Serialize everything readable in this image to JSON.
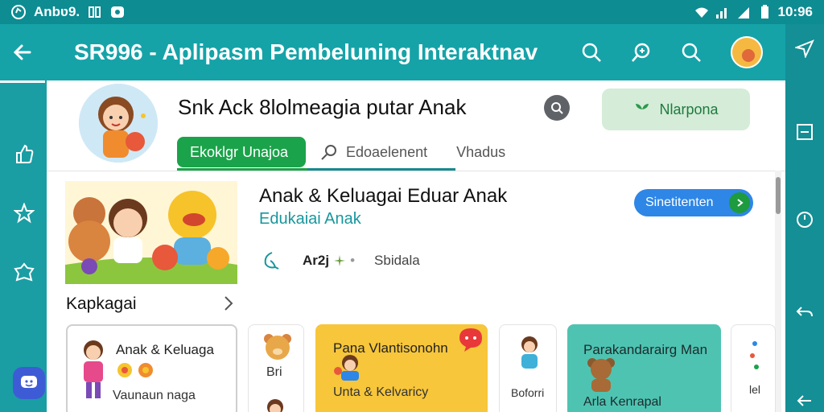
{
  "status_bar": {
    "app_label": "Anbʋ9.",
    "clock": "10:96"
  },
  "app_bar": {
    "title": "SR996 - Aplipasm Pembeluning Interaktnav"
  },
  "profile": {
    "title": "Snk Ack 8lolmeagia putar Anak",
    "action_label": "Nlarpona"
  },
  "tabs": [
    {
      "label": "Ekoklgr Unajoa"
    },
    {
      "label": "Edoaelenent"
    },
    {
      "label": "Vhadus"
    }
  ],
  "featured": {
    "title": "Anak & Keluagai Eduar Anak",
    "subtitle": "Edukaiai Anak",
    "rating": "Ar2j",
    "meta_label": "Sbidala",
    "button_label": "Sinetitenten"
  },
  "section": {
    "title": "Kapkagai"
  },
  "cards": [
    {
      "title": "Anak & Keluaga",
      "subtitle": "Vaunaun naga"
    },
    {
      "title": "Bri"
    },
    {
      "title": "Pana Vlantisonohn",
      "subtitle": "Unta & Kelvaricy"
    },
    {
      "title": "Boforri"
    },
    {
      "title": "Parakandarairg Man",
      "subtitle": "Arla Kenrapal"
    },
    {
      "title": "lel"
    }
  ],
  "colors": {
    "teal": "#15a3a8",
    "green": "#1aa34a",
    "blue": "#2e86e6",
    "yellow": "#f7c63a",
    "mint": "#4fc3b2"
  }
}
